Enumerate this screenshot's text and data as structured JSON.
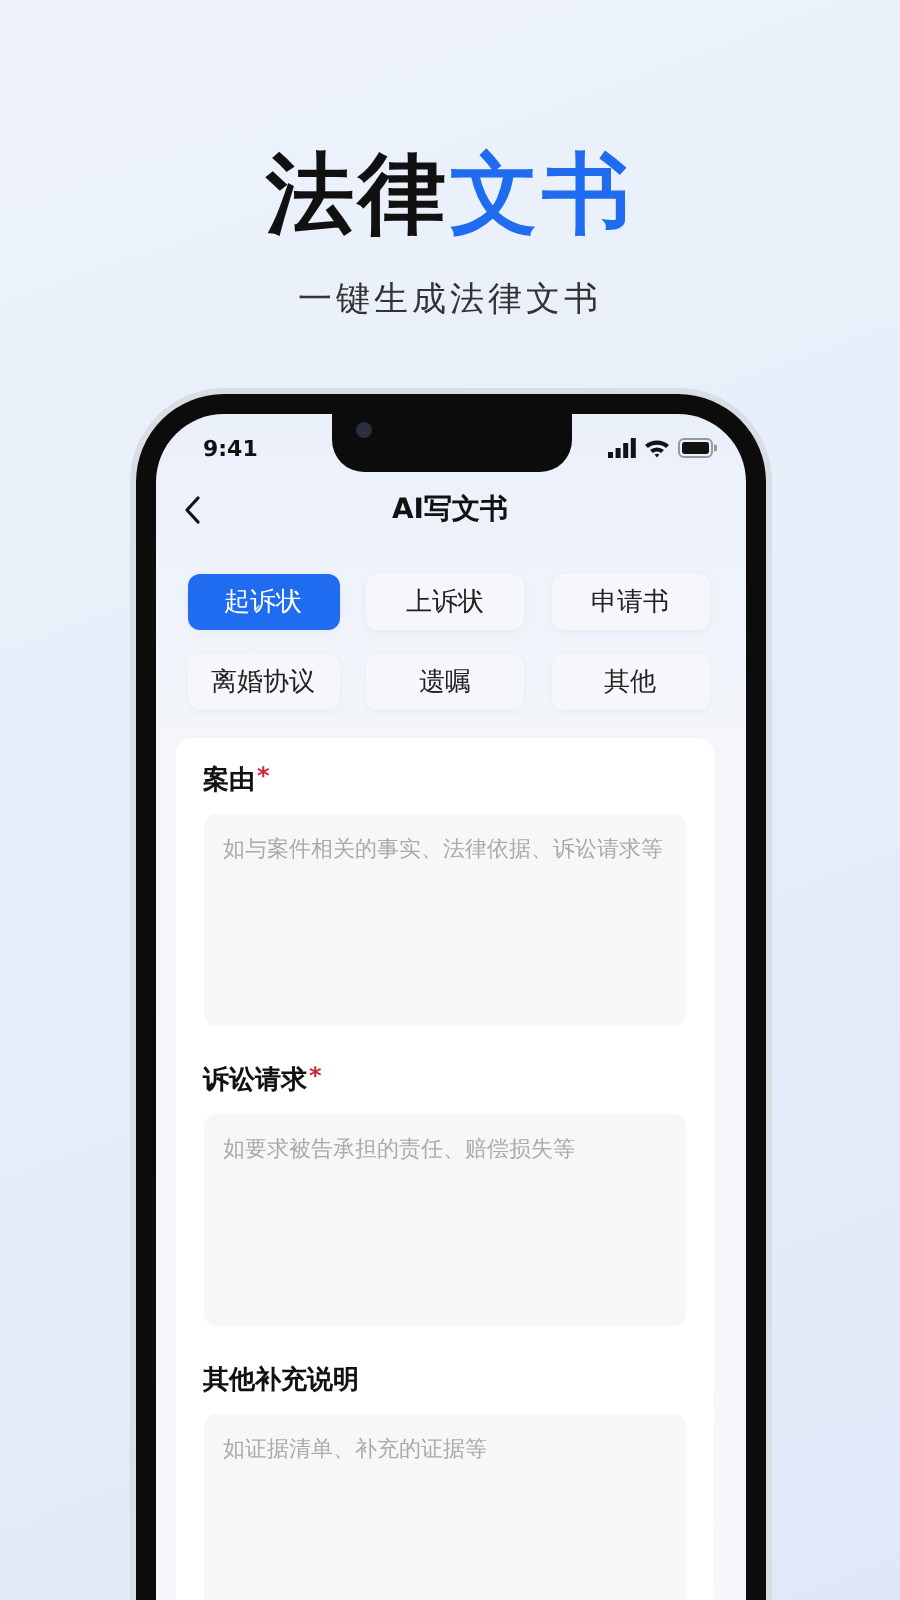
{
  "headline": [
    {
      "text": "法律",
      "kind": "plain"
    },
    {
      "text": "文书",
      "kind": "accent"
    }
  ],
  "subtitle": "一键生成法律文书",
  "status_bar": {
    "time": "9:41"
  },
  "nav": {
    "title": "AI写文书"
  },
  "doc_types": [
    {
      "label": "起诉状",
      "selected": true
    },
    {
      "label": "上诉状",
      "selected": false
    },
    {
      "label": "申请书",
      "selected": false
    },
    {
      "label": "离婚协议",
      "selected": false
    },
    {
      "label": "遗嘱",
      "selected": false
    },
    {
      "label": "其他",
      "selected": false
    }
  ],
  "fields": [
    {
      "label": "案由",
      "required_mark": "*",
      "placeholder": "如与案件相关的事实、法律依据、诉讼请求等"
    },
    {
      "label": "诉讼请求",
      "required_mark": "*",
      "placeholder": "如要求被告承担的责任、赔偿损失等"
    },
    {
      "label": "其他补充说明",
      "placeholder": "如证据清单、补充的证据等"
    }
  ]
}
